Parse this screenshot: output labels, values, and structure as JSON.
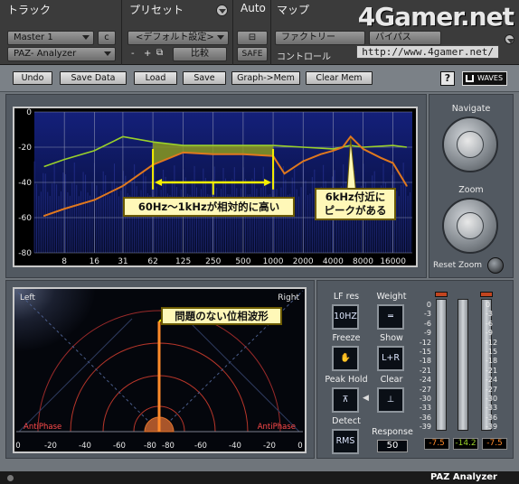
{
  "host": {
    "track_label": "トラック",
    "preset_label": "プリセット",
    "auto_label": "Auto",
    "map_label": "マップ",
    "track_name": "Master 1",
    "track_channel": "c",
    "plugin_name": "PAZ- Analyzer",
    "preset_name": "<デフォルト設定>",
    "minus": "-",
    "plus": "+",
    "compare": "比較",
    "safe": "SAFE",
    "factory": "ファクトリー",
    "bypass": "バイパス",
    "control": "コントロール",
    "watermark": "4Gamer.net",
    "url": "http://www.4gamer.net/"
  },
  "toolbar": {
    "undo": "Undo",
    "save_data": "Save Data",
    "load": "Load",
    "save": "Save",
    "graph_mem": "Graph->Mem",
    "clear_mem": "Clear Mem",
    "help": "?",
    "brand": "WAVES"
  },
  "spectrum": {
    "y_ticks": [
      "0",
      "-20",
      "-40",
      "-60",
      "-80"
    ],
    "x_ticks": [
      "8",
      "16",
      "31",
      "62",
      "125",
      "250",
      "500",
      "1000",
      "2000",
      "4000",
      "8000",
      "16000"
    ],
    "callout_range": "60Hz～1kHzが相対的に高い",
    "callout_peak_line1": "6kHz付近に",
    "callout_peak_line2": "ピークがある",
    "colors": {
      "current": "#e0781e",
      "memory": "#9ad12a",
      "fill": "#8a9a1e",
      "bg": "#000814"
    }
  },
  "chart_data": {
    "type": "line",
    "xscale": "log",
    "xlim": [
      4,
      25000
    ],
    "ylim": [
      -80,
      0
    ],
    "series": [
      {
        "x": [
          5,
          8,
          16,
          31,
          62,
          125,
          250,
          500,
          1000,
          1300,
          2000,
          3000,
          4000,
          5000,
          6000,
          8000,
          12000,
          16000,
          22000
        ],
        "values": [
          -59,
          -55,
          -50,
          -42,
          -30,
          -23,
          -24,
          -24,
          -25,
          -35,
          -28,
          -24,
          -22,
          -20,
          -14,
          -21,
          -26,
          -29,
          -42
        ]
      },
      {
        "x": [
          5,
          8,
          16,
          31,
          62,
          125,
          250,
          500,
          1000,
          2000,
          4000,
          6000,
          8000,
          16000,
          22000
        ],
        "values": [
          -31,
          -27,
          -22,
          -14,
          -17,
          -19,
          -19,
          -19,
          -19,
          -20,
          -21,
          -19,
          -20,
          -19,
          -20
        ]
      }
    ]
  },
  "navigate": {
    "title": "Navigate",
    "zoom": "Zoom",
    "reset": "Reset Zoom"
  },
  "phase": {
    "left": "Left",
    "right": "Right",
    "anti_left": "AntiPhase",
    "anti_right": "AntiPhase",
    "x_ticks": [
      "0",
      "-20",
      "-40",
      "-60",
      "-80",
      "-80",
      "-60",
      "-40",
      "-20",
      "0"
    ],
    "callout": "問題のない位相波形"
  },
  "controls": {
    "lf_res_label": "LF res",
    "lf_res_value": "10HZ",
    "weight_label": "Weight",
    "freeze_label": "Freeze",
    "show_label": "Show",
    "show_value": "L+R",
    "peak_hold_label": "Peak Hold",
    "clear_label": "Clear",
    "detect_label": "Detect",
    "detect_value": "RMS",
    "response_label": "Response",
    "response_value": "50"
  },
  "meters": {
    "scale": [
      "0",
      "-3",
      "-6",
      "-9",
      "-12",
      "-15",
      "-18",
      "-21",
      "-24",
      "-27",
      "-30",
      "-33",
      "-36",
      "-39"
    ],
    "left_value": "-7.5",
    "center_value": "-14.2",
    "right_value": "-7.5"
  },
  "footer": {
    "name": "PAZ Analyzer"
  }
}
